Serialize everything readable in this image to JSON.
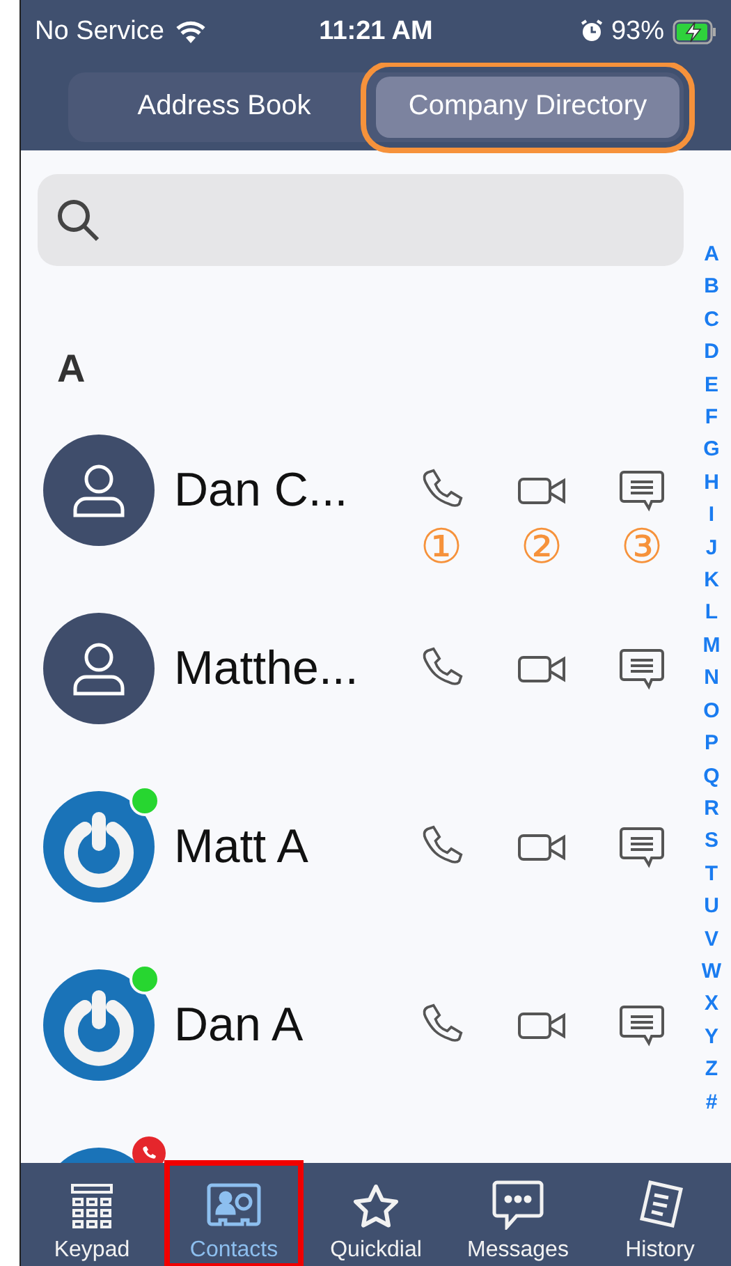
{
  "status_bar": {
    "carrier": "No Service",
    "time": "11:21 AM",
    "battery": "93%",
    "charging": true
  },
  "segments": [
    {
      "label": "Address Book",
      "selected": false,
      "highlighted": false
    },
    {
      "label": "Company Directory",
      "selected": true,
      "highlighted": true
    }
  ],
  "section": "A",
  "contacts": [
    {
      "name": "Dan C...",
      "kind": "person",
      "action_labels": [
        "①",
        "②",
        "③"
      ]
    },
    {
      "name": "Matthe...",
      "kind": "person"
    },
    {
      "name": "Matt A",
      "kind": "logo",
      "color": "#27d630"
    },
    {
      "name": "Dan A",
      "kind": "logo",
      "color": "#27d630"
    },
    {
      "kind": "logo",
      "call_badge": true
    }
  ],
  "index": [
    "A",
    "B",
    "C",
    "D",
    "E",
    "F",
    "G",
    "H",
    "I",
    "J",
    "K",
    "L",
    "M",
    "N",
    "O",
    "P",
    "Q",
    "R",
    "S",
    "T",
    "U",
    "V",
    "W",
    "X",
    "Y",
    "Z",
    "#"
  ],
  "tabs": [
    {
      "label": "Keypad",
      "kind": "keypad",
      "selected": false,
      "highlighted": false
    },
    {
      "label": "Contacts",
      "kind": "contacts",
      "selected": true,
      "highlighted": true
    },
    {
      "label": "Quickdial",
      "kind": "star",
      "selected": false,
      "highlighted": false
    },
    {
      "label": "Messages",
      "kind": "messages",
      "selected": false,
      "highlighted": false
    },
    {
      "label": "History",
      "kind": "history",
      "selected": false,
      "highlighted": false
    }
  ]
}
